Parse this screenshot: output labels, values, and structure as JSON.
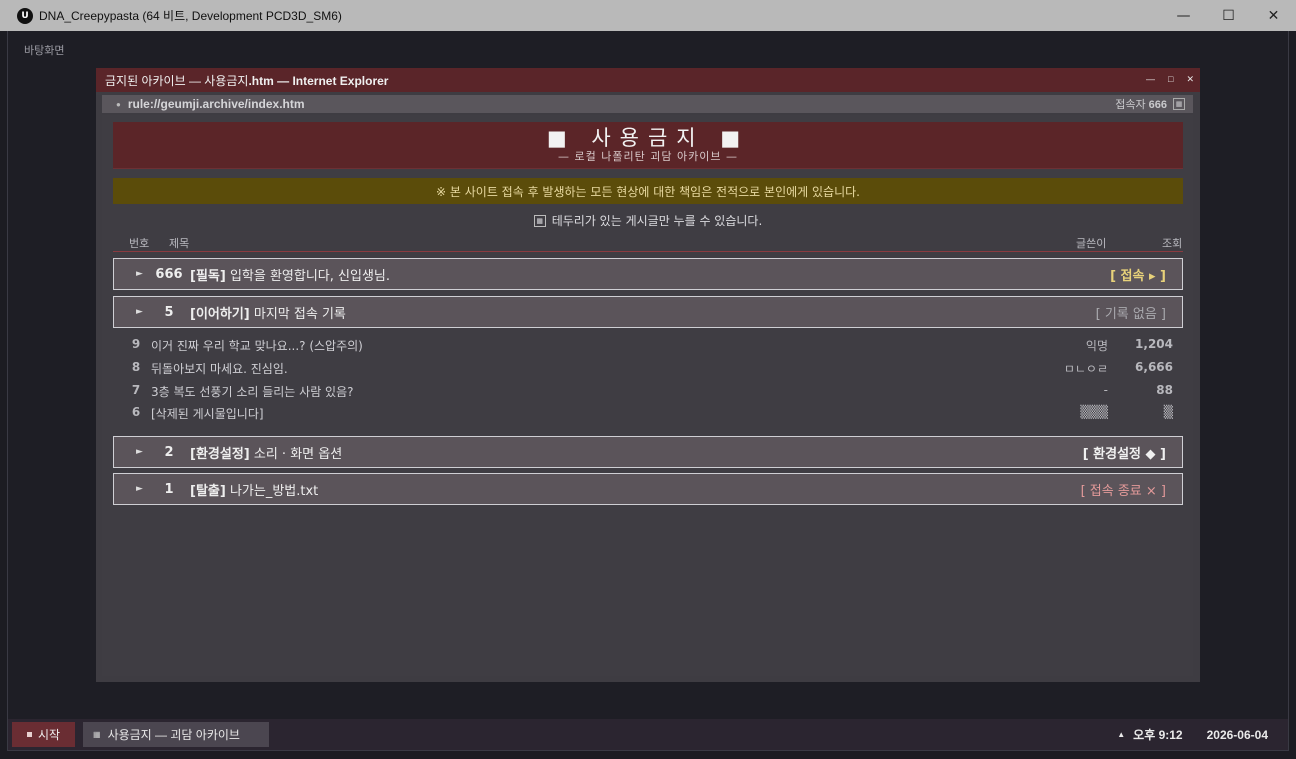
{
  "app": {
    "window_title": "DNA_Creepypasta (64 비트, Development PCD3D_SM6)",
    "logo_text": "U",
    "desktop_label": "바탕화면"
  },
  "ie": {
    "title_prefix": "금지된 아카이브 — 사용금지",
    "title_suffix": ".htm — Internet Explorer",
    "url": "rule://geumji.archive/index.htm",
    "visitors_label": "접속자",
    "visitors_count": "666"
  },
  "page": {
    "banner_title": "■ 사용금지 ■",
    "banner_subtitle": "— 로컬 나폴리탄 괴담 아카이브 —",
    "warning": "※ 본 사이트 접속 후 발생하는 모든 현상에 대한 책임은 전적으로 본인에게 있습니다.",
    "hint": "테두리가 있는 게시글만 누를 수 있습니다.",
    "headers": {
      "num": "번호",
      "title": "제목",
      "author": "글쓴이",
      "views": "조회"
    }
  },
  "boxed_rows": [
    {
      "num": "666",
      "tag": "[필독]",
      "title": "입학을 환영합니다, 신입생님.",
      "action": "[ 접속 ▸ ]",
      "action_color": "#e8d27a"
    },
    {
      "num": "5",
      "tag": "[이어하기]",
      "title": "마지막 접속 기록",
      "action": "[ 기록 없음 ]",
      "action_color": "#a9a9ae"
    }
  ],
  "plain_rows": [
    {
      "num": "9",
      "title": "이거 진짜 우리 학교 맞나요...? (스압주의)",
      "author": "익명",
      "views": "1,204"
    },
    {
      "num": "8",
      "title": "뒤돌아보지 마세요. 진심임.",
      "author": "ㅁㄴㅇㄹ",
      "views": "6,666"
    },
    {
      "num": "7",
      "title": "3층 복도 선풍기 소리 들리는 사람 있음?",
      "author": "-",
      "views": "88"
    },
    {
      "num": "6",
      "title": "[삭제된 게시물입니다]",
      "author": "▒▒▒",
      "views": "▒"
    }
  ],
  "menu_rows": [
    {
      "num": "2",
      "tag": "[환경설정]",
      "title": "소리 · 화면 옵션",
      "action": "[ 환경설정 ◆ ]",
      "action_color": "#f0f0f0"
    },
    {
      "num": "1",
      "tag": "[탈출]",
      "title": "나가는_방법.txt",
      "action": "[ 접속 종료 × ]",
      "action_color": "#e39a9a"
    }
  ],
  "taskbar": {
    "start_label": "시작",
    "task_label": "사용금지 — 괴담 아카이브",
    "time": "오후 9:12",
    "date": "2026-06-04"
  }
}
